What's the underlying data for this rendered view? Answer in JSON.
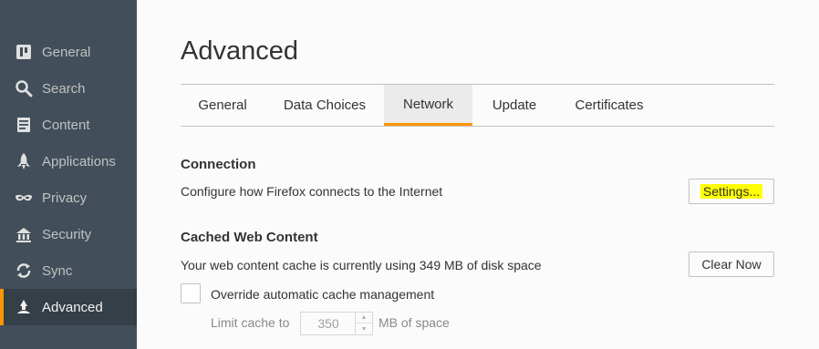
{
  "sidebar": {
    "items": [
      {
        "label": "General",
        "icon": "general-icon"
      },
      {
        "label": "Search",
        "icon": "search-icon"
      },
      {
        "label": "Content",
        "icon": "content-icon"
      },
      {
        "label": "Applications",
        "icon": "applications-icon"
      },
      {
        "label": "Privacy",
        "icon": "privacy-mask-icon"
      },
      {
        "label": "Security",
        "icon": "security-icon"
      },
      {
        "label": "Sync",
        "icon": "sync-icon"
      },
      {
        "label": "Advanced",
        "icon": "advanced-icon",
        "active": true
      }
    ]
  },
  "main": {
    "title": "Advanced",
    "tabs": [
      {
        "label": "General"
      },
      {
        "label": "Data Choices"
      },
      {
        "label": "Network",
        "active": true
      },
      {
        "label": "Update"
      },
      {
        "label": "Certificates"
      }
    ],
    "connection": {
      "title": "Connection",
      "description": "Configure how Firefox connects to the Internet",
      "settings_button": "Settings..."
    },
    "cache": {
      "title": "Cached Web Content",
      "description": "Your web content cache is currently using 349 MB of disk space",
      "clear_button": "Clear Now",
      "override_label": "Override automatic cache management",
      "override_checked": false,
      "limit_label": "Limit cache to",
      "limit_value": "350",
      "limit_unit": "MB of space"
    }
  },
  "colors": {
    "sidebar_bg": "#424f5a",
    "accent": "#ff9500",
    "highlight": "#ffff00"
  }
}
